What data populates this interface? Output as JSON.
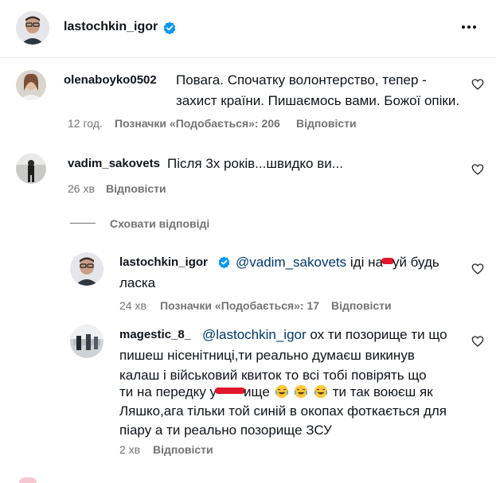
{
  "header": {
    "username": "lastochkin_igor",
    "more_label": "•••"
  },
  "comments": [
    {
      "username": "olenaboyko0502",
      "text": "Повага. Спочатку волонтерство, тепер - захист країни. Пишаємось вами. Божої опіки.",
      "time": "12 год.",
      "likes": "Позначки «Подобається»: 206",
      "reply": "Відповісти"
    },
    {
      "username": "vadim_sakovets",
      "text": "Після 3х років...швидко ви...",
      "time": "26 хв",
      "reply": "Відповісти",
      "hide_replies": "Сховати відповіді"
    }
  ],
  "replies": [
    {
      "username": "lastochkin_igor",
      "mention": "@vadim_sakovets",
      "text_pre": "іді на",
      "text_post": "уй будь",
      "text_line2": "ласка",
      "time": "24 хв",
      "likes": "Позначки «Подобається»: 17",
      "reply": "Відповісти"
    },
    {
      "username": "magestic_8_",
      "mention": "@lastochkin_igor",
      "line1": "ох ти позорище ти що",
      "line2": "пишеш нісенітниці,ти реально думаєш викинув",
      "line3": "калаш і військовий квиток то всі тобі повірять що",
      "line4_pre": "ти на передку у",
      "line4_mid": "ище",
      "line4_post": "ти так воюєш як",
      "line5": "Ляшко,ага тільки той синій в окопах фоткається для",
      "line6": "піару а ти реально позорище ЗСУ",
      "time": "2 хв",
      "reply": "Відповісти"
    }
  ]
}
